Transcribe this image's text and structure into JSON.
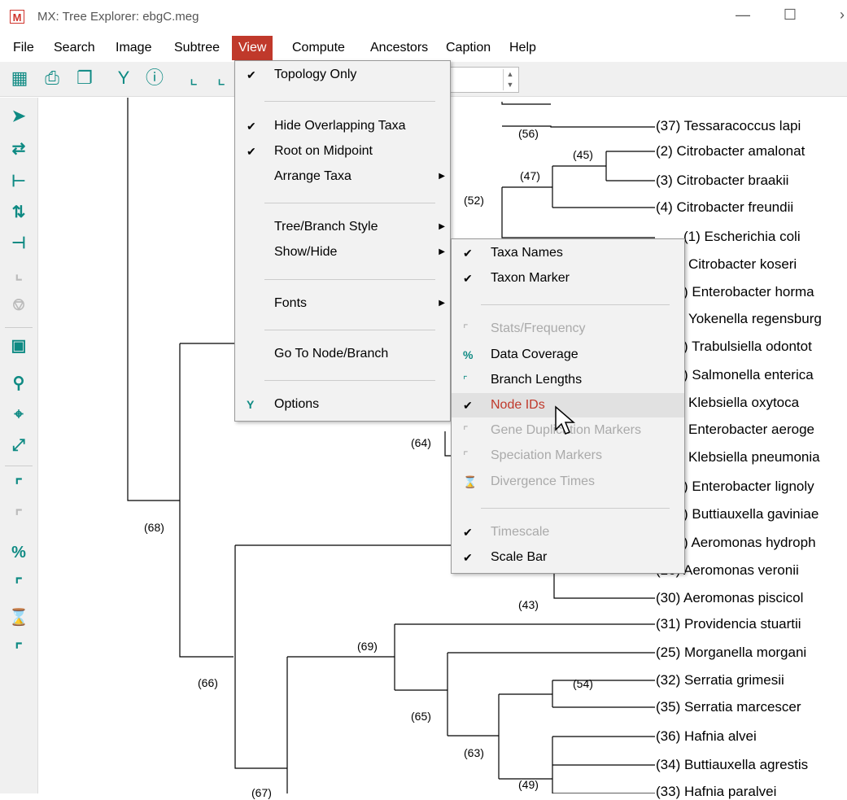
{
  "window": {
    "title": "MX: Tree Explorer: ebgC.meg",
    "logo": "M"
  },
  "menubar": [
    "File",
    "Search",
    "Image",
    "Subtree",
    "View",
    "Compute",
    "Ancestors",
    "Caption",
    "Help"
  ],
  "view_menu": [
    {
      "label": "Topology Only",
      "checked": true
    },
    {
      "label": "Hide Overlapping Taxa",
      "checked": true
    },
    {
      "label": "Root on Midpoint",
      "checked": true
    },
    {
      "label": "Arrange Taxa",
      "submenu": true
    },
    {
      "label": "Tree/Branch Style",
      "submenu": true
    },
    {
      "label": "Show/Hide",
      "submenu": true
    },
    {
      "label": "Fonts",
      "submenu": true
    },
    {
      "label": "Go To Node/Branch"
    },
    {
      "label": "Options",
      "icon": "wrench-icon"
    }
  ],
  "showhide_menu": [
    {
      "label": "Taxa Names",
      "checked": true
    },
    {
      "label": "Taxon Marker",
      "checked": true
    },
    {
      "label": "Stats/Frequency",
      "disabled": true,
      "icon": "stats-icon"
    },
    {
      "label": "Data Coverage",
      "icon": "percent-icon"
    },
    {
      "label": "Branch Lengths",
      "icon": "branch-length-icon"
    },
    {
      "label": "Node IDs",
      "checked": true,
      "highlighted": true
    },
    {
      "label": "Gene Duplication Markers",
      "disabled": true,
      "icon": "gene-dup-icon"
    },
    {
      "label": "Speciation Markers",
      "disabled": true,
      "icon": "speciation-icon"
    },
    {
      "label": "Divergence Times",
      "disabled": true,
      "icon": "divergence-icon"
    },
    {
      "label": "Timescale",
      "checked": true,
      "disabled": true
    },
    {
      "label": "Scale Bar",
      "checked": true
    }
  ],
  "taxa": [
    "(37) Tessaracoccus lapi",
    "(2) Citrobacter amalonat",
    "(3) Citrobacter braakii",
    "(4) Citrobacter freundii",
    "(1) Escherichia coli",
    "Citrobacter koseri",
    ") Enterobacter horma",
    "Yokenella regensburg",
    ") Trabulsiella odontot",
    ") Salmonella enterica",
    "Klebsiella oxytoca",
    "Enterobacter aeroge",
    "Klebsiella pneumonia",
    ") Enterobacter lignoly",
    ") Buttiauxella gaviniae",
    ") Aeromonas hydroph",
    "(26) Aeromonas veronii",
    "(30) Aeromonas piscicol",
    "(31) Providencia stuartii",
    "(25) Morganella morgani",
    "(32) Serratia grimesii",
    "(35) Serratia marcescer",
    "(36) Hafnia alvei",
    "(34) Buttiauxella agrestis",
    "(33) Hafnia paralvei"
  ],
  "node_ids": [
    "(56)",
    "(45)",
    "(47)",
    "(52)",
    "(64)",
    "(68)",
    "(43)",
    "(69)",
    "(66)",
    "(54)",
    "(65)",
    "(63)",
    "(49)",
    "(67)"
  ],
  "colors": {
    "accent": "#0e8a83",
    "menu_active": "#c0392b"
  }
}
